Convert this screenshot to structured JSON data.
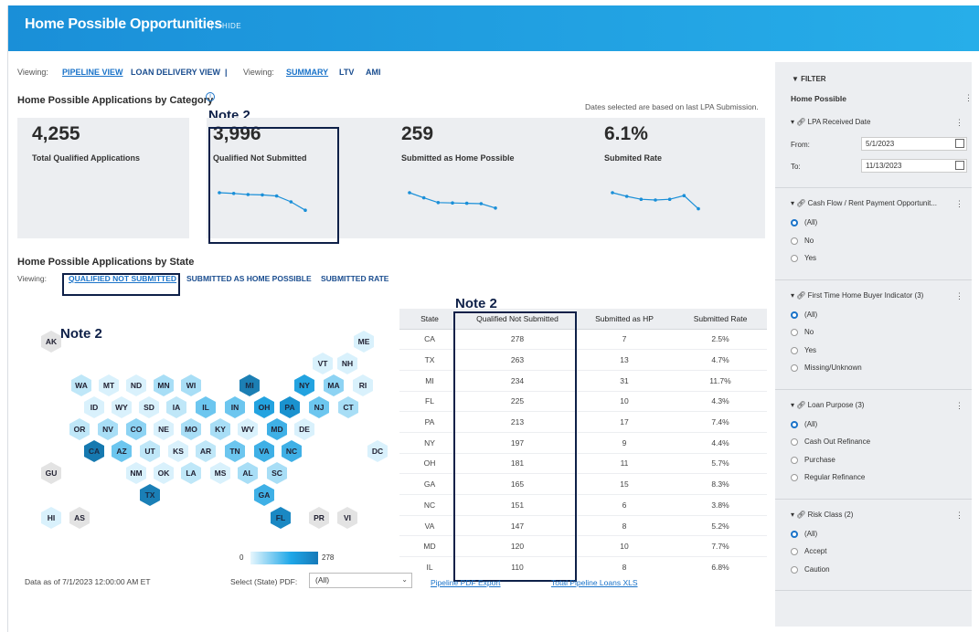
{
  "header": {
    "title": "Home Possible Opportunities",
    "hide_label": "HIDE"
  },
  "viewing": {
    "label1": "Viewing:",
    "pipeline": "PIPELINE VIEW",
    "loan_delivery": "LOAN DELIVERY VIEW",
    "divider": "|",
    "label2": "Viewing:",
    "summary": "SUMMARY",
    "ltv": "LTV",
    "ami": "AMI"
  },
  "category": {
    "title": "Home Possible Applications by Category",
    "info_icon": "i",
    "dates_note": "Dates selected are based on last LPA Submission.",
    "kpis": [
      {
        "value": "4,255",
        "label": "Total Qualified Applications"
      },
      {
        "value": "3,996",
        "label": "Qualified Not Submitted"
      },
      {
        "value": "259",
        "label": "Submitted as Home Possible"
      },
      {
        "value": "6.1%",
        "label": "Submited Rate"
      }
    ]
  },
  "notes": {
    "n1": "Note 2",
    "n2": "Note 2",
    "n3": "Note 2"
  },
  "state_section": {
    "title": "Home Possible Applications by State",
    "viewing_label": "Viewing:",
    "tabs": [
      "QUALIFIED NOT SUBMITTED",
      "SUBMITTED AS HOME POSSIBLE",
      "SUBMITTED RATE"
    ],
    "legend_min": "0",
    "legend_max": "278"
  },
  "hexmap": [
    {
      "s": "AK",
      "c": "#e3e3e3"
    },
    {
      "s": "ME",
      "c": "#d9f1fc"
    },
    {
      "s": "VT",
      "c": "#d9f1fc"
    },
    {
      "s": "NH",
      "c": "#d9f1fc"
    },
    {
      "s": "WA",
      "c": "#bfe7f8"
    },
    {
      "s": "MT",
      "c": "#d9f1fc"
    },
    {
      "s": "ND",
      "c": "#d9f1fc"
    },
    {
      "s": "MN",
      "c": "#a8def6"
    },
    {
      "s": "WI",
      "c": "#a8def6"
    },
    {
      "s": "MI",
      "c": "#1c7fb4"
    },
    {
      "s": "NY",
      "c": "#23a3e0"
    },
    {
      "s": "MA",
      "c": "#8dd3f3"
    },
    {
      "s": "RI",
      "c": "#d9f1fc"
    },
    {
      "s": "ID",
      "c": "#d9f1fc"
    },
    {
      "s": "WY",
      "c": "#d9f1fc"
    },
    {
      "s": "SD",
      "c": "#d9f1fc"
    },
    {
      "s": "IA",
      "c": "#bfe7f8"
    },
    {
      "s": "IL",
      "c": "#6cc6ef"
    },
    {
      "s": "IN",
      "c": "#6cc6ef"
    },
    {
      "s": "OH",
      "c": "#23a3e0"
    },
    {
      "s": "PA",
      "c": "#1a92cf"
    },
    {
      "s": "NJ",
      "c": "#6cc6ef"
    },
    {
      "s": "CT",
      "c": "#a8def6"
    },
    {
      "s": "OR",
      "c": "#bfe7f8"
    },
    {
      "s": "NV",
      "c": "#a8def6"
    },
    {
      "s": "CO",
      "c": "#8dd3f3"
    },
    {
      "s": "NE",
      "c": "#d9f1fc"
    },
    {
      "s": "MO",
      "c": "#a8def6"
    },
    {
      "s": "KY",
      "c": "#a8def6"
    },
    {
      "s": "WV",
      "c": "#d9f1fc"
    },
    {
      "s": "MD",
      "c": "#3fb0e6"
    },
    {
      "s": "DE",
      "c": "#d9f1fc"
    },
    {
      "s": "CA",
      "c": "#1679b0"
    },
    {
      "s": "AZ",
      "c": "#6cc6ef"
    },
    {
      "s": "UT",
      "c": "#bfe7f8"
    },
    {
      "s": "KS",
      "c": "#d9f1fc"
    },
    {
      "s": "AR",
      "c": "#bfe7f8"
    },
    {
      "s": "TN",
      "c": "#6cc6ef"
    },
    {
      "s": "VA",
      "c": "#3fb0e6"
    },
    {
      "s": "NC",
      "c": "#3fb0e6"
    },
    {
      "s": "DC",
      "c": "#d9f1fc"
    },
    {
      "s": "GU",
      "c": "#e3e3e3"
    },
    {
      "s": "NM",
      "c": "#d9f1fc"
    },
    {
      "s": "OK",
      "c": "#d9f1fc"
    },
    {
      "s": "LA",
      "c": "#bfe7f8"
    },
    {
      "s": "MS",
      "c": "#d9f1fc"
    },
    {
      "s": "AL",
      "c": "#a8def6"
    },
    {
      "s": "SC",
      "c": "#a8def6"
    },
    {
      "s": "TX",
      "c": "#1a7fb6"
    },
    {
      "s": "GA",
      "c": "#3fb0e6"
    },
    {
      "s": "HI",
      "c": "#d9f1fc"
    },
    {
      "s": "AS",
      "c": "#e3e3e3"
    },
    {
      "s": "FL",
      "c": "#1a88c3"
    },
    {
      "s": "PR",
      "c": "#e3e3e3"
    },
    {
      "s": "VI",
      "c": "#e3e3e3"
    }
  ],
  "table": {
    "headers": [
      "State",
      "Qualified Not Submitted",
      "Submitted as HP",
      "Submitted Rate"
    ],
    "rows": [
      [
        "CA",
        "278",
        "7",
        "2.5%"
      ],
      [
        "TX",
        "263",
        "13",
        "4.7%"
      ],
      [
        "MI",
        "234",
        "31",
        "11.7%"
      ],
      [
        "FL",
        "225",
        "10",
        "4.3%"
      ],
      [
        "PA",
        "213",
        "17",
        "7.4%"
      ],
      [
        "NY",
        "197",
        "9",
        "4.4%"
      ],
      [
        "OH",
        "181",
        "11",
        "5.7%"
      ],
      [
        "GA",
        "165",
        "15",
        "8.3%"
      ],
      [
        "NC",
        "151",
        "6",
        "3.8%"
      ],
      [
        "VA",
        "147",
        "8",
        "5.2%"
      ],
      [
        "MD",
        "120",
        "10",
        "7.7%"
      ],
      [
        "IL",
        "110",
        "8",
        "6.8%"
      ]
    ]
  },
  "footer": {
    "data_as_of": "Data as of 7/1/2023 12:00:00 AM ET",
    "select_label": "Select (State) PDF:",
    "select_value": "(All)",
    "pdf_export": "Pipeline PDF Export",
    "xls_export": "Total Pipeline Loans XLS"
  },
  "filter": {
    "title": "FILTER",
    "section": "Home Possible",
    "lpa": {
      "label": "LPA Received Date",
      "from_label": "From:",
      "from": "5/1/2023",
      "to_label": "To:",
      "to": "11/13/2023"
    },
    "groups": [
      {
        "label": "Cash Flow / Rent Payment Opportunit...",
        "options": [
          "(All)",
          "No",
          "Yes"
        ]
      },
      {
        "label": "First Time Home Buyer Indicator (3)",
        "options": [
          "(All)",
          "No",
          "Yes",
          "Missing/Unknown"
        ]
      },
      {
        "label": "Loan Purpose (3)",
        "options": [
          "(All)",
          "Cash Out Refinance",
          "Purchase",
          "Regular Refinance"
        ]
      },
      {
        "label": "Risk Class (2)",
        "options": [
          "(All)",
          "Accept",
          "Caution"
        ]
      }
    ]
  },
  "colors": {
    "brand": "#1a8fd8",
    "note_box": "#0e2048",
    "link": "#1a73c9"
  },
  "sparklines": {
    "qualified_not_submitted": [
      8,
      7.8,
      7.5,
      7.4,
      7.1,
      5.5,
      3.2
    ],
    "submitted_as_home_possible": [
      8,
      6.6,
      5.3,
      5.2,
      5.1,
      5.0,
      3.8
    ],
    "submitted_rate": [
      8,
      7.0,
      6.2,
      6.0,
      6.2,
      7.2,
      3.6
    ]
  }
}
